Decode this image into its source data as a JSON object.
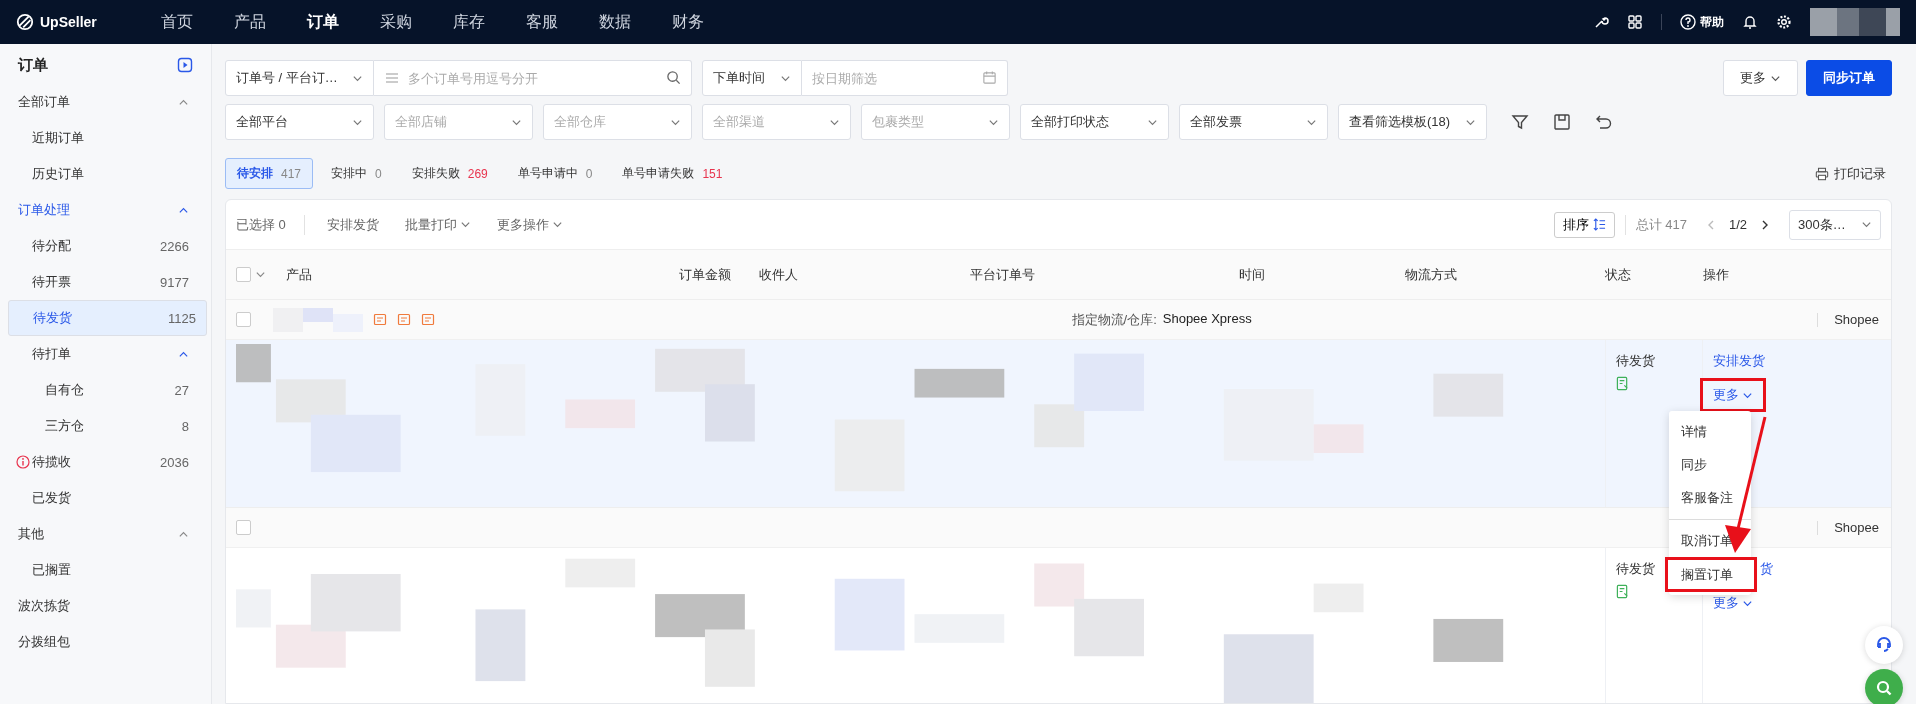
{
  "topbar": {
    "logo": "UpSeller",
    "nav": [
      {
        "label": "首页",
        "selected": false
      },
      {
        "label": "产品",
        "selected": false
      },
      {
        "label": "订单",
        "selected": true
      },
      {
        "label": "采购",
        "selected": false
      },
      {
        "label": "库存",
        "selected": false
      },
      {
        "label": "客服",
        "selected": false
      },
      {
        "label": "数据",
        "selected": false
      },
      {
        "label": "财务",
        "selected": false
      }
    ],
    "help": "帮助"
  },
  "sidebar": {
    "title": "订单",
    "groups": [
      {
        "label": "全部订单",
        "expanded": true,
        "active": false,
        "children": [
          {
            "label": "近期订单",
            "selected": false
          },
          {
            "label": "历史订单",
            "selected": false
          }
        ]
      },
      {
        "label": "订单处理",
        "expanded": true,
        "active": true,
        "children": [
          {
            "label": "待分配",
            "count": "2266",
            "selected": false
          },
          {
            "label": "待开票",
            "count": "9177",
            "selected": false
          },
          {
            "label": "待发货",
            "count": "1125",
            "selected": true
          },
          {
            "label": "待打单",
            "expanded": true,
            "selected": false,
            "children": [
              {
                "label": "自有仓",
                "count": "27",
                "selected": false
              },
              {
                "label": "三方仓",
                "count": "8",
                "selected": false
              }
            ]
          },
          {
            "label": "待揽收",
            "count": "2036",
            "alert": true,
            "selected": false
          },
          {
            "label": "已发货",
            "selected": false
          }
        ]
      },
      {
        "label": "其他",
        "expanded": true,
        "active": false,
        "children": [
          {
            "label": "已搁置",
            "selected": false
          }
        ]
      },
      {
        "label": "波次拣货",
        "active": false
      },
      {
        "label": "分拨组包",
        "active": false
      }
    ]
  },
  "filters": {
    "search_type": "订单号 / 平台订…",
    "search_placeholder": "多个订单号用逗号分开",
    "time_type": "下单时间",
    "date_placeholder": "按日期筛选",
    "more": "更多",
    "sync": "同步订单",
    "selects": [
      {
        "text": "全部平台",
        "placeholder": false
      },
      {
        "text": "全部店铺",
        "placeholder": true
      },
      {
        "text": "全部仓库",
        "placeholder": true
      },
      {
        "text": "全部渠道",
        "placeholder": true
      },
      {
        "text": "包裹类型",
        "placeholder": true
      },
      {
        "text": "全部打印状态",
        "placeholder": false
      },
      {
        "text": "全部发票",
        "placeholder": false
      },
      {
        "text": "查看筛选模板(18)",
        "placeholder": false
      }
    ]
  },
  "status_tabs": [
    {
      "label": "待安排",
      "count": "417",
      "selected": true,
      "warning": false
    },
    {
      "label": "安排中",
      "count": "0",
      "selected": false,
      "warning": false
    },
    {
      "label": "安排失败",
      "count": "269",
      "selected": false,
      "warning": true
    },
    {
      "label": "单号申请中",
      "count": "0",
      "selected": false,
      "warning": false
    },
    {
      "label": "单号申请失败",
      "count": "151",
      "selected": false,
      "warning": true
    }
  ],
  "print_log": "打印记录",
  "toolbar": {
    "selected_label": "已选择",
    "selected_count": "0",
    "actions": [
      {
        "label": "安排发货",
        "dropdown": false
      },
      {
        "label": "批量打印",
        "dropdown": true
      },
      {
        "label": "更多操作",
        "dropdown": true
      }
    ],
    "sort": "排序",
    "total": "总计 417",
    "page": "1/2",
    "page_size": "300条…"
  },
  "table": {
    "all_checked": false,
    "columns": [
      "产品",
      "订单金额",
      "收件人",
      "平台订单号",
      "时间",
      "物流方式",
      "状态",
      "操作"
    ],
    "orders": [
      {
        "checked": false,
        "logistics_label": "指定物流/仓库:",
        "logistics": "Shopee Xpress",
        "platform": "Shopee",
        "flags": true,
        "hovered": true,
        "status": "待发货",
        "primary_action": "安排发货",
        "primary_clipped": false,
        "more": "更多",
        "more_highlighted": true
      },
      {
        "checked": false,
        "platform": "Shopee",
        "flags": false,
        "hovered": false,
        "status": "待发货",
        "primary_action": "货",
        "primary_clipped": true,
        "more": "更多",
        "more_highlighted": false
      }
    ]
  },
  "menu": {
    "items": [
      {
        "label": "详情",
        "highlighted": false,
        "divider_before": false
      },
      {
        "label": "同步",
        "highlighted": false,
        "divider_before": false
      },
      {
        "label": "客服备注",
        "highlighted": false,
        "divider_before": false
      },
      {
        "label": "取消订单",
        "highlighted": false,
        "divider_before": true
      },
      {
        "label": "搁置订单",
        "highlighted": true,
        "divider_before": false
      }
    ]
  }
}
